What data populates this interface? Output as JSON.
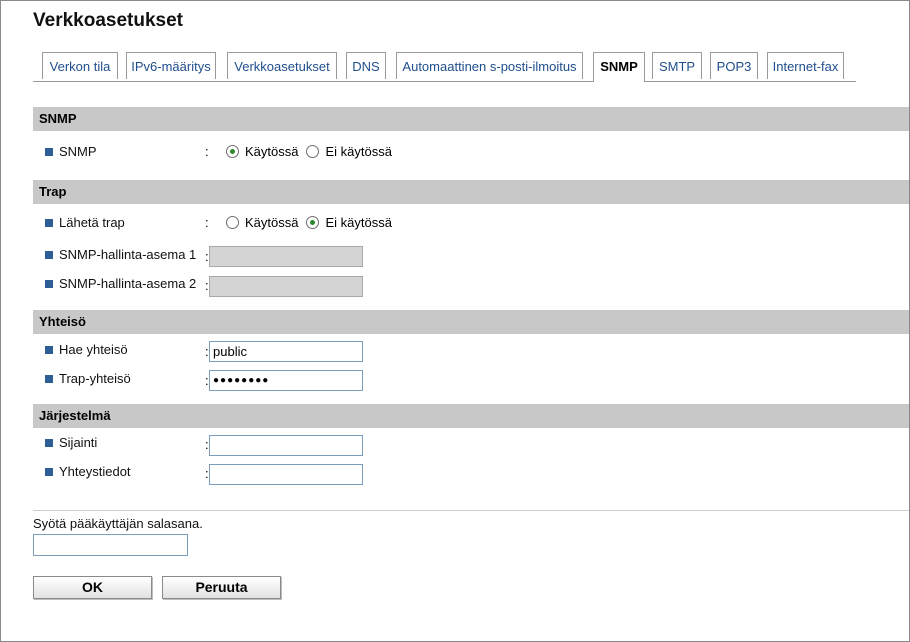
{
  "page_title": "Verkkoasetukset",
  "tabs": [
    {
      "label": "Verkon tila"
    },
    {
      "label": "IPv6-määritys"
    },
    {
      "label": "Verkkoasetukset"
    },
    {
      "label": "DNS"
    },
    {
      "label": "Automaattinen s-posti-ilmoitus"
    },
    {
      "label": "SNMP",
      "active": true
    },
    {
      "label": "SMTP"
    },
    {
      "label": "POP3"
    },
    {
      "label": "Internet-fax"
    }
  ],
  "sections": {
    "snmp": {
      "title": "SNMP",
      "snmp_label": "SNMP",
      "option_enabled": "Käytössä",
      "option_disabled": "Ei käytössä",
      "selected": "Käytössä"
    },
    "trap": {
      "title": "Trap",
      "send_trap_label": "Lähetä trap",
      "option_enabled": "Käytössä",
      "option_disabled": "Ei käytössä",
      "selected": "Ei käytössä",
      "station1_label": "SNMP-hallinta-asema 1",
      "station1_value": "",
      "station2_label": "SNMP-hallinta-asema 2",
      "station2_value": ""
    },
    "community": {
      "title": "Yhteisö",
      "get_label": "Hae yhteisö",
      "get_value": "public",
      "trap_label": "Trap-yhteisö",
      "trap_value": "●●●●●●●●"
    },
    "system": {
      "title": "Järjestelmä",
      "location_label": "Sijainti",
      "location_value": "",
      "contact_label": "Yhteystiedot",
      "contact_value": ""
    }
  },
  "colon": ":",
  "password_prompt": "Syötä pääkäyttäjän salasana.",
  "buttons": {
    "ok": "OK",
    "cancel": "Peruuta"
  },
  "colors": {
    "section_bar": "#c8c8c8",
    "tab_link": "#1f4e8c",
    "bullet": "#2e5f94",
    "radio_checked": "#2c8a2c"
  }
}
